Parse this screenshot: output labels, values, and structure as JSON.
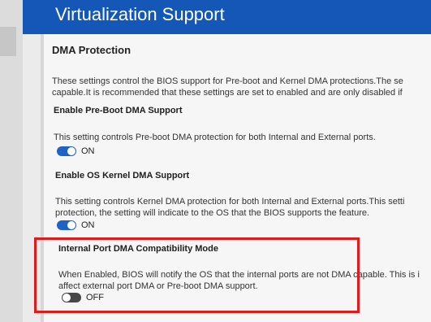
{
  "header": {
    "title": "Virtualization Support"
  },
  "section": {
    "title": "DMA Protection",
    "desc_line1": "These settings control the BIOS support for Pre-boot and Kernel DMA protections.The se",
    "desc_line2": "capable.It is recommended that these settings are set to enabled and are only disabled if"
  },
  "settings": [
    {
      "title": "Enable Pre-Boot DMA Support",
      "desc_line1": "This setting controls Pre-boot DMA protection for both Internal and External ports.",
      "desc_line2": "",
      "state": "ON"
    },
    {
      "title": "Enable OS Kernel DMA Support",
      "desc_line1": "This setting controls Kernel DMA protection for both Internal and External ports.This setti",
      "desc_line2": "protection, the setting will indicate to the OS that the BIOS supports the feature.",
      "state": "ON"
    },
    {
      "title": "Internal Port DMA Compatibility Mode",
      "desc_line1": "When Enabled, BIOS will notify the OS that the internal ports are not DMA capable. This is i",
      "desc_line2": "affect external port DMA or Pre-boot DMA support.",
      "state": "OFF"
    }
  ],
  "colors": {
    "header_bg": "#1457b7",
    "toggle_on": "#1f63c6",
    "toggle_off": "#474747",
    "highlight": "#e01b1b"
  }
}
